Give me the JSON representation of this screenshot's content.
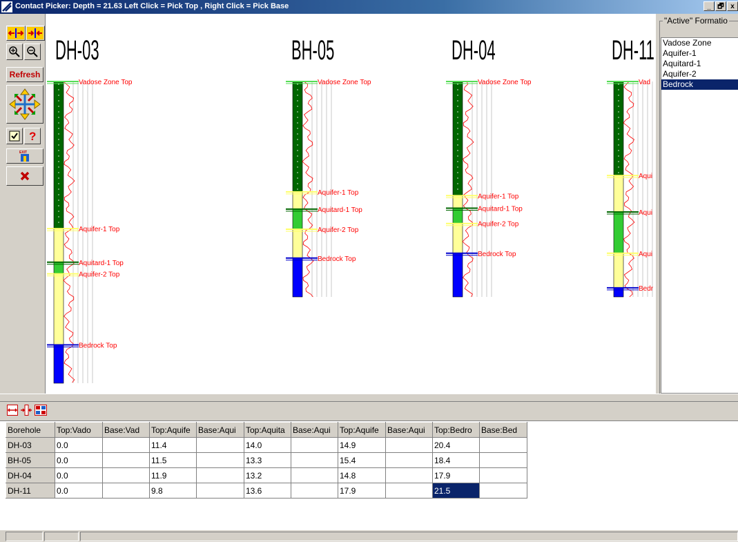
{
  "window": {
    "title": "Contact Picker: Depth = 21.63 Left Click = Pick Top , Right Click = Pick Base",
    "controls": [
      "_",
      "🗗",
      "x"
    ]
  },
  "toolbar": {
    "refresh_label": "Refresh"
  },
  "boreholes": [
    {
      "name": "DH-03",
      "depth": 24.0,
      "picks": [
        {
          "label": "Vadose Zone Top",
          "depth": 0.0
        },
        {
          "label": "Aquifer-1 Top",
          "depth": 11.4
        },
        {
          "label": "Aquitard-1 Top",
          "depth": 14.0
        },
        {
          "label": "Aquifer-2 Top",
          "depth": 14.9
        },
        {
          "label": "Bedrock Top",
          "depth": 20.4
        }
      ]
    },
    {
      "name": "BH-05",
      "depth": 24.0,
      "picks": [
        {
          "label": "Vadose Zone Top",
          "depth": 0.0
        },
        {
          "label": "Aquifer-1 Top",
          "depth": 11.5
        },
        {
          "label": "Aquitard-1 Top",
          "depth": 13.3
        },
        {
          "label": "Aquifer-2 Top",
          "depth": 15.4
        },
        {
          "label": "Bedrock Top",
          "depth": 18.4
        }
      ]
    },
    {
      "name": "DH-04",
      "depth": 24.0,
      "picks": [
        {
          "label": "Vadose Zone Top",
          "depth": 0.0
        },
        {
          "label": "Aquifer-1 Top",
          "depth": 11.9
        },
        {
          "label": "Aquitard-1 Top",
          "depth": 13.2
        },
        {
          "label": "Aquifer-2 Top",
          "depth": 14.8
        },
        {
          "label": "Bedrock Top",
          "depth": 17.9
        }
      ]
    },
    {
      "name": "DH-11",
      "depth": 24.0,
      "picks": [
        {
          "label": "Vad",
          "depth": 0.0
        },
        {
          "label": "Aqui",
          "depth": 9.8
        },
        {
          "label": "Aqui",
          "depth": 13.6
        },
        {
          "label": "Aqui",
          "depth": 17.9
        },
        {
          "label": "Bedr",
          "depth": 21.5
        }
      ]
    }
  ],
  "formations": {
    "title": "\"Active\" Formatio",
    "items": [
      "Vadose Zone",
      "Aquifer-1",
      "Aquitard-1",
      "Aquifer-2",
      "Bedrock"
    ],
    "selected": "Bedrock"
  },
  "grid": {
    "headers": [
      "Borehole",
      "Top:Vado",
      "Base:Vad",
      "Top:Aquife",
      "Base:Aqui",
      "Top:Aquita",
      "Base:Aqui",
      "Top:Aquife",
      "Base:Aqui",
      "Top:Bedro",
      "Base:Bed"
    ],
    "rows": [
      [
        "DH-03",
        "0.0",
        "",
        "11.4",
        "",
        "14.0",
        "",
        "14.9",
        "",
        "20.4",
        ""
      ],
      [
        "BH-05",
        "0.0",
        "",
        "11.5",
        "",
        "13.3",
        "",
        "15.4",
        "",
        "18.4",
        ""
      ],
      [
        "DH-04",
        "0.0",
        "",
        "11.9",
        "",
        "13.2",
        "",
        "14.8",
        "",
        "17.9",
        ""
      ],
      [
        "DH-11",
        "0.0",
        "",
        "9.8",
        "",
        "13.6",
        "",
        "17.9",
        "",
        "21.5",
        ""
      ]
    ]
  },
  "colors": {
    "vadose": "#33cc33",
    "aquifer": "#ffff99",
    "aquitard": "#006600",
    "bedrock": "#0000ff",
    "pick_text": "#ff0000",
    "selection": "#0a246a"
  }
}
